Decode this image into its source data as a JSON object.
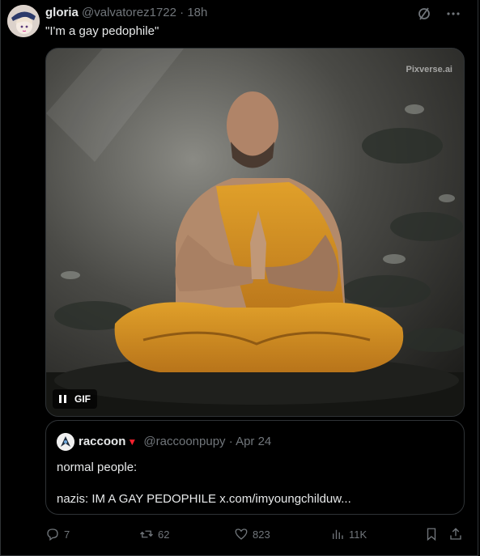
{
  "tweet": {
    "author_name": "gloria",
    "author_handle": "@valvatorez1722",
    "separator": "·",
    "time": "18h",
    "text": "\"I'm a gay pedophile\"",
    "media": {
      "watermark": "Pixverse.ai",
      "badge_label": "GIF"
    }
  },
  "quote": {
    "author_name": "raccoon",
    "badge": "▼",
    "author_handle": "@raccoonpupy",
    "separator": "·",
    "date": "Apr 24",
    "line1": "normal people:",
    "line2": "nazis: IM A GAY PEDOPHILE x.com/imyoungchilduw..."
  },
  "actions": {
    "replies": "7",
    "reposts": "62",
    "likes": "823",
    "views": "11K"
  },
  "colors": {
    "background": "#000000",
    "text": "#e7e9ea",
    "muted": "#71767b",
    "border": "#2f3336",
    "quote_badge": "#f4212e"
  },
  "icons": [
    "grok-icon",
    "more-icon",
    "pause-icon",
    "reply-icon",
    "repost-icon",
    "like-icon",
    "views-icon",
    "bookmark-icon",
    "share-icon"
  ]
}
